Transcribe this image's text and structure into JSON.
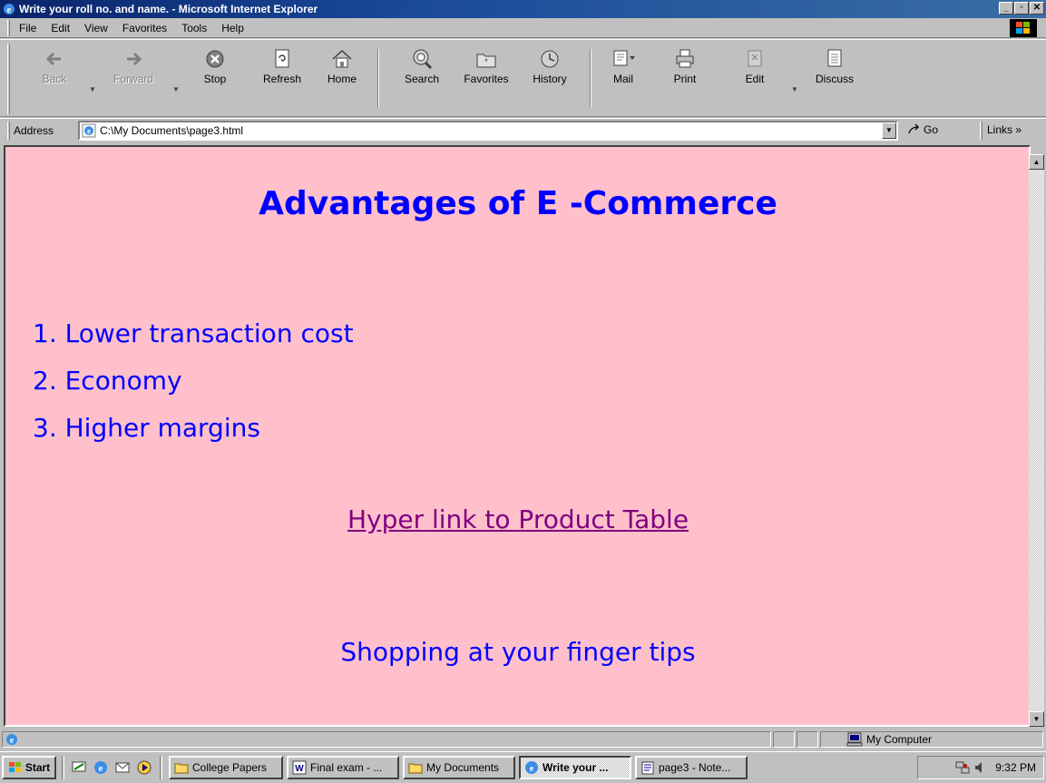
{
  "window": {
    "title": "Write your roll no. and name. - Microsoft Internet Explorer",
    "controls": {
      "minimize": "_",
      "maximize": "▫",
      "close": "✕"
    }
  },
  "menu": {
    "items": [
      {
        "label": "File",
        "key": "F",
        "rest": "ile"
      },
      {
        "label": "Edit",
        "key": "E",
        "rest": "dit"
      },
      {
        "label": "View",
        "key": "V",
        "rest": "iew"
      },
      {
        "label": "Favorites",
        "key": "a",
        "pre": "F",
        "rest": "vorites"
      },
      {
        "label": "Tools",
        "key": "T",
        "rest": "ools"
      },
      {
        "label": "Help",
        "key": "H",
        "rest": "elp"
      }
    ]
  },
  "toolbar": {
    "back": "Back",
    "forward": "Forward",
    "stop": "Stop",
    "refresh": "Refresh",
    "home": "Home",
    "search": "Search",
    "favorites": "Favorites",
    "history": "History",
    "mail": "Mail",
    "print": "Print",
    "edit": "Edit",
    "discuss": "Discuss"
  },
  "address": {
    "label": "Address",
    "value": "C:\\My Documents\\page3.html",
    "go": "Go",
    "links": "Links »"
  },
  "page": {
    "heading": "Advantages of E -Commerce",
    "list": [
      "1. Lower transaction cost",
      "2. Economy",
      "3. Higher margins"
    ],
    "link": "Hyper link to Product Table",
    "tagline": "Shopping at your finger tips",
    "colors": {
      "background": "#ffc0cb",
      "text": "#0000ff",
      "visited_link": "#800080"
    }
  },
  "status": {
    "zone": "My Computer"
  },
  "taskbar": {
    "start": "Start",
    "tasks": [
      {
        "label": "College Papers",
        "icon": "folder-icon"
      },
      {
        "label": "Final exam - ...",
        "icon": "word-icon"
      },
      {
        "label": "My Documents",
        "icon": "folder-icon"
      },
      {
        "label": "Write your ...",
        "icon": "ie-icon",
        "active": true
      },
      {
        "label": "page3 - Note...",
        "icon": "notepad-icon"
      }
    ],
    "clock": "9:32 PM"
  }
}
